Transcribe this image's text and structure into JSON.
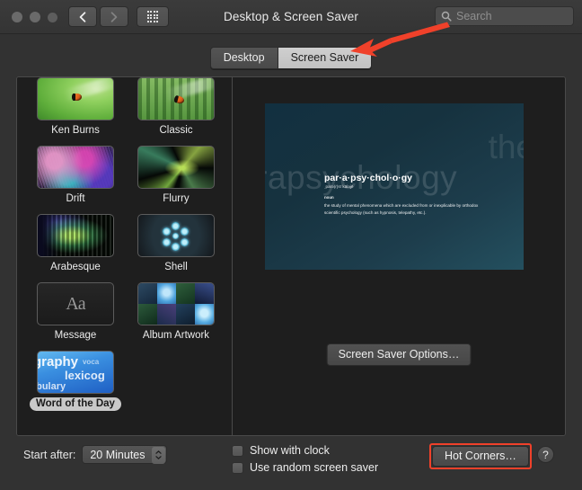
{
  "window": {
    "title": "Desktop & Screen Saver",
    "traffic_lights": [
      "close",
      "minimize",
      "zoom"
    ],
    "nav": {
      "back_icon": "chevron-left-icon",
      "forward_icon": "chevron-right-icon",
      "grid_icon": "show-all-grid-icon"
    },
    "search": {
      "placeholder": "Search",
      "value": "",
      "icon": "search-icon"
    }
  },
  "tabs": [
    {
      "label": "Desktop",
      "selected": false
    },
    {
      "label": "Screen Saver",
      "selected": true
    }
  ],
  "screensavers": [
    {
      "label": "Ken Burns",
      "selected": false,
      "art": "ken"
    },
    {
      "label": "Classic",
      "selected": false,
      "art": "classic"
    },
    {
      "label": "Drift",
      "selected": false,
      "art": "drift"
    },
    {
      "label": "Flurry",
      "selected": false,
      "art": "flurry"
    },
    {
      "label": "Arabesque",
      "selected": false,
      "art": "arabesque"
    },
    {
      "label": "Shell",
      "selected": false,
      "art": "shell"
    },
    {
      "label": "Message",
      "selected": false,
      "art": "message"
    },
    {
      "label": "Album Artwork",
      "selected": false,
      "art": "album"
    },
    {
      "label": "Word of the Day",
      "selected": true,
      "art": "word"
    }
  ],
  "message_thumb_text": "Aa",
  "word_thumb": {
    "w1": "graphy",
    "w2": "lexicog",
    "w3": "abulary",
    "w4": "voca"
  },
  "preview": {
    "ghost_word": "parapsychology",
    "ghost_word_right": "the",
    "headword": "par·a·psy·chol·o·gy",
    "pronunciation": "ˌparə(r)sīˈkäləjē",
    "part_of_speech": "noun",
    "definition": "the study of mental phenomena which are excluded from or inexplicable by orthodox scientific psychology (such as hypnosis, telepathy, etc.)."
  },
  "options_button": "Screen Saver Options…",
  "bottom": {
    "start_after_label": "Start after:",
    "start_after_value": "20 Minutes",
    "show_with_clock": {
      "label": "Show with clock",
      "checked": false
    },
    "use_random": {
      "label": "Use random screen saver",
      "checked": false
    },
    "hot_corners": "Hot Corners…",
    "help": "?"
  },
  "annotations": {
    "arrow_color": "#f0412a",
    "highlight_color": "#f0412a",
    "arrow_target": "Screen Saver tab",
    "highlight_target": "Hot Corners… button"
  }
}
